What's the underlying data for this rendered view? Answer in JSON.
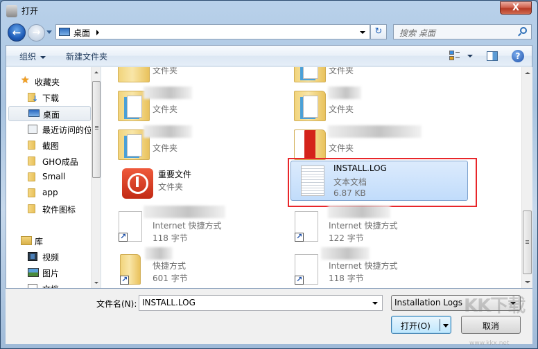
{
  "window": {
    "title": "打开",
    "close_label": "X"
  },
  "nav": {
    "back_label": "←",
    "forward_label": "→",
    "breadcrumb": [
      "桌面"
    ],
    "refresh_label": "↻",
    "search_placeholder": "搜索 桌面"
  },
  "toolbar": {
    "organize_label": "组织",
    "new_folder_label": "新建文件夹",
    "help_label": "?"
  },
  "sidebar": {
    "favorites": {
      "label": "收藏夹",
      "icon": "star-icon"
    },
    "favorite_items": [
      {
        "label": "下载",
        "icon": "downloads-folder-icon"
      },
      {
        "label": "桌面",
        "icon": "desktop-icon",
        "selected": true
      },
      {
        "label": "最近访问的位置",
        "icon": "recent-places-icon"
      },
      {
        "label": "截图",
        "icon": "folder-icon"
      },
      {
        "label": "GHO成品",
        "icon": "folder-icon"
      },
      {
        "label": "Small",
        "icon": "folder-icon"
      },
      {
        "label": "app",
        "icon": "folder-icon"
      },
      {
        "label": "软件图标",
        "icon": "folder-icon"
      }
    ],
    "libraries": {
      "label": "库",
      "icon": "library-icon"
    },
    "library_items": [
      {
        "label": "视频",
        "icon": "video-icon"
      },
      {
        "label": "图片",
        "icon": "pictures-icon"
      },
      {
        "label": "文档",
        "icon": "documents-icon"
      }
    ]
  },
  "files": [
    {
      "name": "",
      "type": "文件夹",
      "size": "",
      "icon": "folder-icon",
      "blurred": false
    },
    {
      "name": "",
      "type": "文件夹",
      "size": "",
      "icon": "folder-icon",
      "blurred": false
    },
    {
      "name": "",
      "type": "文件夹",
      "size": "",
      "icon": "folder-icon",
      "blurred": true
    },
    {
      "name": "",
      "type": "文件夹",
      "size": "",
      "icon": "folder-icon",
      "blurred": true
    },
    {
      "name": "",
      "type": "文件夹",
      "size": "",
      "icon": "folder-icon",
      "blurred": true
    },
    {
      "name": "",
      "type": "文件夹",
      "size": "",
      "icon": "folder-icon",
      "blurred": true
    },
    {
      "name": "重要文件",
      "type": "文件夹",
      "size": "",
      "icon": "stop-icon",
      "blurred": false
    },
    {
      "name": "INSTALL.LOG",
      "type": "文本文档",
      "size": "6.87 KB",
      "icon": "text-file-icon",
      "selected": true
    },
    {
      "name": "",
      "type": "Internet 快捷方式",
      "size": "118 字节",
      "icon": "internet-shortcut-icon",
      "blurred": true
    },
    {
      "name": "",
      "type": "Internet 快捷方式",
      "size": "122 字节",
      "icon": "internet-shortcut-icon",
      "blurred": true
    },
    {
      "name": "",
      "type": "快捷方式",
      "size": "601 字节",
      "icon": "folder-shortcut-icon",
      "blurred": true
    },
    {
      "name": "",
      "type": "Internet 快捷方式",
      "size": "118 字节",
      "icon": "internet-shortcut-icon",
      "blurred": true
    }
  ],
  "bottom": {
    "filename_label": "文件名(N):",
    "filename_value": "INSTALL.LOG",
    "filetype_value": "Installation Logs",
    "open_label": "打开(O)",
    "cancel_label": "取消"
  },
  "watermark": {
    "text": "KK下载",
    "url": "www.kkx.net"
  },
  "colors": {
    "highlight_box": "#e8262a",
    "selection": "#c1dcfb",
    "close_button": "#c7432b"
  }
}
